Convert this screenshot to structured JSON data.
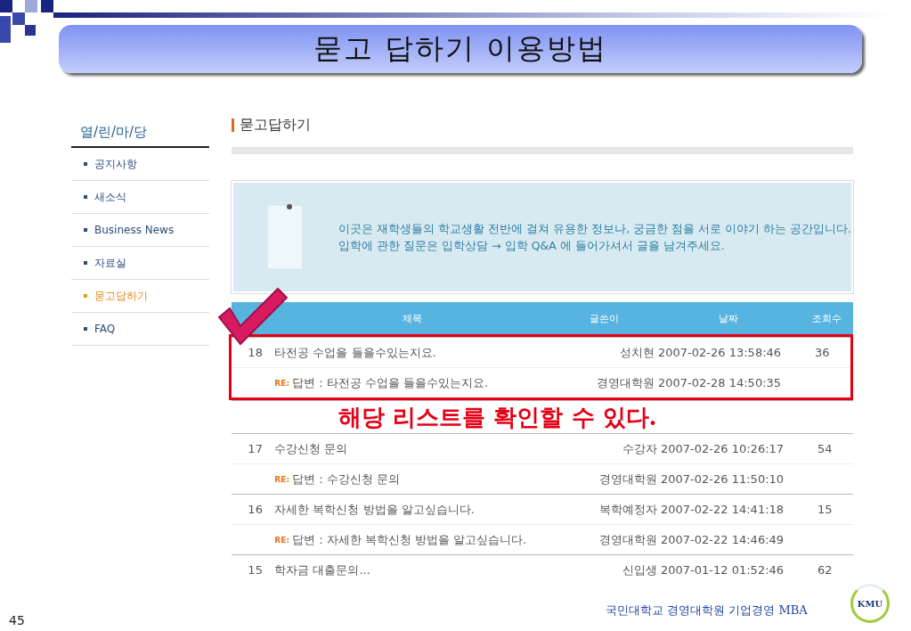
{
  "slide": {
    "title": "묻고 답하기 이용방법",
    "page_number": "45",
    "footer": "국민대학교 경영대학원 기업경영 MBA",
    "logo": "KMU"
  },
  "sidebar": {
    "title": "열/린/마/당",
    "items": [
      {
        "label": "공지사항",
        "selected": false
      },
      {
        "label": "새소식",
        "selected": false
      },
      {
        "label": "Business News",
        "selected": false
      },
      {
        "label": "자료실",
        "selected": false
      },
      {
        "label": "묻고답하기",
        "selected": true
      },
      {
        "label": "FAQ",
        "selected": false
      }
    ]
  },
  "page_heading": "묻고답하기",
  "notice": {
    "lines": [
      "이곳은 재학생들의 학교생활 전반에 걸쳐 유용한 정보나, 궁금한 점을 서로 이야기 하는 공간입니다.",
      "입학에 관한 질문은 입학상담 → 입학 Q&A 에 들어가셔서 글을 남겨주세요."
    ]
  },
  "table": {
    "columns": [
      "제목",
      "글쓴이",
      "날짜",
      "조회수"
    ],
    "rows": [
      {
        "kind": "post",
        "highlighted": true,
        "number": "18",
        "title": "타전공 수업을 들을수있는지요.",
        "author": "성치현",
        "date": "2007-02-26 13:58:46",
        "views": "36"
      },
      {
        "kind": "reply",
        "highlighted": true,
        "badge": "RE:",
        "title": "답변 : 타전공 수업을 들을수있는지요.",
        "author": "경영대학원",
        "date": "2007-02-28 14:50:35"
      },
      {
        "kind": "post",
        "highlighted": false,
        "number": "17",
        "title": "수강신청 문의",
        "author": "수강자",
        "date": "2007-02-26 10:26:17",
        "views": "54"
      },
      {
        "kind": "reply",
        "highlighted": false,
        "badge": "RE:",
        "title": "답변 : 수강신청 문의",
        "author": "경영대학원",
        "date": "2007-02-26 11:50:10"
      },
      {
        "kind": "post",
        "highlighted": false,
        "number": "16",
        "title": "자세한 복학신청 방법을 알고싶습니다.",
        "author": "복학예정자",
        "date": "2007-02-22 14:41:18",
        "views": "15"
      },
      {
        "kind": "reply",
        "highlighted": false,
        "badge": "RE:",
        "title": "답변 : 자세한 복학신청 방법을 알고싶습니다.",
        "author": "경영대학원",
        "date": "2007-02-22 14:46:49"
      },
      {
        "kind": "post",
        "highlighted": false,
        "number": "15",
        "title": "학자금 대출문의...",
        "author": "신입생",
        "date": "2007-01-12 01:52:46",
        "views": "62"
      }
    ]
  },
  "annotation": "해당 리스트를 확인할 수 있다."
}
